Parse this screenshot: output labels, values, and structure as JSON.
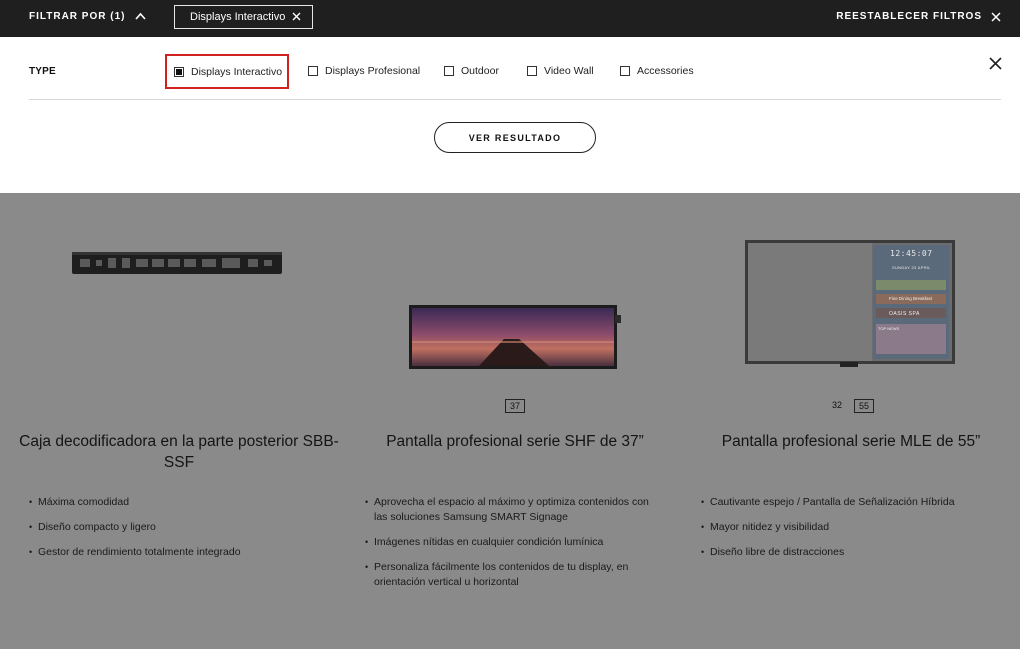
{
  "topbar": {
    "filter_toggle_label": "FILTRAR POR (1)",
    "chip_label": "Displays Interactivo",
    "reset_label": "REESTABLECER FILTROS"
  },
  "panel": {
    "type_label": "TYPE",
    "options": [
      {
        "label": "Displays Interactivo",
        "checked": true
      },
      {
        "label": "Displays Profesional",
        "checked": false
      },
      {
        "label": "Outdoor",
        "checked": false
      },
      {
        "label": "Video Wall",
        "checked": false
      },
      {
        "label": "Accessories",
        "checked": false
      }
    ],
    "submit_label": "VER RESULTADO"
  },
  "products": [
    {
      "title": "Caja decodificadora en la parte posterior SBB-SSF",
      "sizes": [],
      "bullets": [
        "Máxima comodidad",
        "Diseño compacto y ligero",
        "Gestor de rendimiento totalmente integrado"
      ]
    },
    {
      "title": "Pantalla profesional serie SHF de 37”",
      "sizes": [
        {
          "label": "37",
          "selected": true
        }
      ],
      "bullets": [
        "Aprovecha el espacio al máximo y optimiza contenidos con las soluciones Samsung SMART Signage",
        "Imágenes nítidas en cualquier condición lumínica",
        "Personaliza fácilmente los contenidos de tu display, en orientación vertical u horizontal"
      ]
    },
    {
      "title": "Pantalla profesional serie MLE de 55”",
      "sizes": [
        {
          "label": "32",
          "selected": false
        },
        {
          "label": "55",
          "selected": true
        }
      ],
      "bullets": [
        "Cautivante espejo / Pantalla de Señalización Híbrida",
        "Mayor nitidez y visibilidad",
        "Diseño libre de distracciones"
      ],
      "screen_text": {
        "time": "12:45:07",
        "date": "SUNDAY 23 APRIL",
        "item1": "Fine Dining Breakfast",
        "item2": "OASIS SPA",
        "news": "TOP NEWS"
      }
    }
  ],
  "colors": {
    "topbar": "#1f1f1f",
    "highlight": "#d02020",
    "overlay": "#8a8a8a"
  }
}
